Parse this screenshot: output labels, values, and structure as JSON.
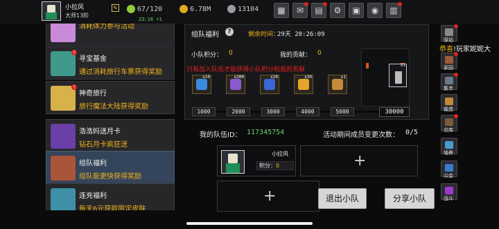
{
  "player": {
    "name": "小拉风",
    "title": "大师13阶",
    "clock": "23:16 +1"
  },
  "resources": [
    {
      "icon": "stamina-icon",
      "value": "67/120",
      "color": "#8fcf3a"
    },
    {
      "icon": "gold-coin-icon",
      "value": "6.78M",
      "color": "#e0a91c"
    },
    {
      "icon": "gem-icon",
      "value": "13104",
      "color": "#9a9aa0"
    }
  ],
  "top_buttons": [
    {
      "name": "shop-icon",
      "glyph": "▦",
      "badge": false
    },
    {
      "name": "mail-icon",
      "glyph": "✉",
      "badge": true
    },
    {
      "name": "notice-icon",
      "glyph": "▤",
      "badge": true
    },
    {
      "name": "settings-icon",
      "glyph": "⚙",
      "badge": false
    },
    {
      "name": "gift-icon",
      "glyph": "▣",
      "badge": false
    },
    {
      "name": "color-wheel-icon",
      "glyph": "◉",
      "badge": false
    },
    {
      "name": "chest-icon",
      "glyph": "▥",
      "badge": true
    }
  ],
  "left_cards": [
    {
      "title": "",
      "subtitle": "消耗体力参与活动",
      "color": "#c98ad8",
      "badge": false,
      "selected": false
    },
    {
      "title": "寻宝基金",
      "subtitle": "通过消耗旅行车票获得奖励",
      "color": "#3f9a8c",
      "badge": true,
      "selected": false
    },
    {
      "title": "神奇旅行",
      "subtitle": "旅行魔法大陆获得奖励",
      "color": "#d7b24a",
      "badge": true,
      "selected": false
    },
    {
      "title": "浩浩妈送月卡",
      "subtitle": "钻石月卡疯狂送",
      "color": "#6a3fa8",
      "badge": false,
      "selected": false
    },
    {
      "title": "组队福利",
      "subtitle": "组队能更快获得奖励",
      "color": "#a8553a",
      "badge": false,
      "selected": true
    },
    {
      "title": "连充福利",
      "subtitle": "每天6元获取限定皮肤",
      "color": "#3f8fa8",
      "badge": false,
      "selected": false
    }
  ],
  "panel": {
    "title": "组队福利",
    "countdown_label": "剩余时间：",
    "countdown_value": "29天 20:26:09",
    "team_points_label": "小队积分：",
    "team_points_value": "0",
    "my_contrib_label": "我的贡献：",
    "my_contrib_value": "0",
    "warning": "只有加入队伍才能获得小队积分和我的贡献",
    "rewards": [
      {
        "icon": "lightning-scroll-icon",
        "count": "x10",
        "color": "#3a8be0"
      },
      {
        "icon": "magic-book-icon",
        "count": "x200",
        "color": "#8a5ad0"
      },
      {
        "icon": "blue-gem-icon",
        "count": "x20",
        "color": "#3a66d8"
      },
      {
        "icon": "golden-egg-icon",
        "count": "x30",
        "color": "#e6a42a"
      },
      {
        "icon": "horn-icon",
        "count": "x1",
        "color": "#c78a3a"
      }
    ],
    "progress": 0,
    "milestones": [
      "1000",
      "2000",
      "3000",
      "4000",
      "5000"
    ],
    "final_milestone": "30000",
    "final_reward_count": "x1"
  },
  "team": {
    "id_label": "我的队伍ID：",
    "id_value": "117345754",
    "changes_label": "活动期间成员变更次数：",
    "changes_value": "0/5",
    "member_name": "小拉风",
    "member_score_label": "积分：",
    "member_score_value": "0",
    "add_symbol": "+"
  },
  "buttons": {
    "leave": "退出小队",
    "share": "分享小队"
  },
  "announcement": {
    "prefix": "恭喜",
    "text": "!玩家妮妮大"
  },
  "right_nav": [
    {
      "label": "驿站",
      "icon": "station-icon",
      "color": "#8a8a8a",
      "badge": true
    },
    {
      "label": "家园",
      "icon": "home-icon",
      "color": "#a05a3a",
      "badge": true
    },
    {
      "label": "集市",
      "icon": "market-icon",
      "color": "#6a7a8a",
      "badge": true
    },
    {
      "label": "锻造",
      "icon": "forge-icon",
      "color": "#c08a3a",
      "badge": false
    },
    {
      "label": "仓库",
      "icon": "warehouse-icon",
      "color": "#7a5a3a",
      "badge": true
    },
    {
      "label": "培养",
      "icon": "train-icon",
      "color": "#4a9ad0",
      "badge": false
    },
    {
      "label": "公会",
      "icon": "guild-icon",
      "color": "#3a7ad0",
      "badge": false
    },
    {
      "label": "战斗",
      "icon": "battle-icon",
      "color": "#9a3ad0",
      "badge": false
    }
  ]
}
